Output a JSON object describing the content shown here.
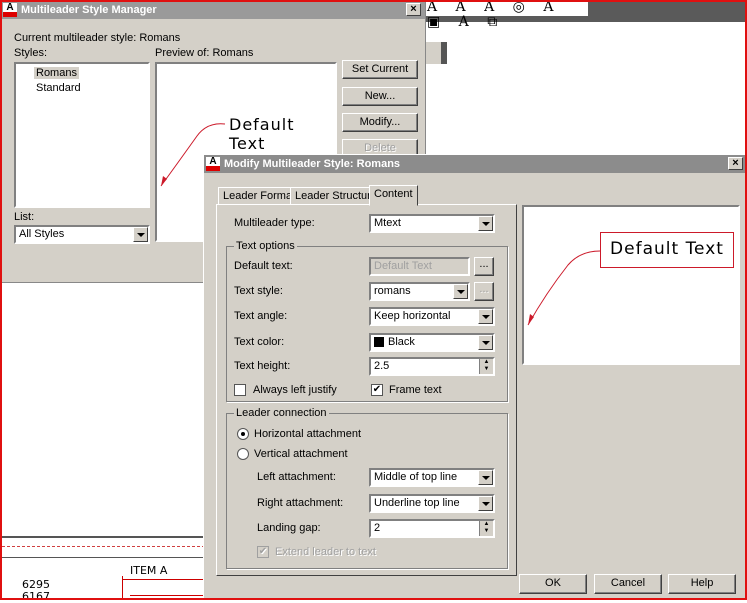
{
  "manager": {
    "title": "Multileader Style Manager",
    "current_style": "Current multileader style: Romans",
    "styles_label": "Styles:",
    "styles": [
      "Romans",
      "Standard"
    ],
    "preview_label": "Preview of: Romans",
    "preview_text": "Default Text",
    "buttons": {
      "set_current": "Set Current",
      "new": "New...",
      "modify": "Modify...",
      "delete": "Delete"
    },
    "list_label": "List:",
    "list_value": "All Styles"
  },
  "modify": {
    "title": "Modify Multileader Style: Romans",
    "tabs": [
      "Leader Format",
      "Leader Structure",
      "Content"
    ],
    "multileader_type_label": "Multileader type:",
    "multileader_type": "Mtext",
    "text_options": {
      "group": "Text options",
      "default_text_label": "Default text:",
      "default_text": "Default Text",
      "text_style_label": "Text style:",
      "text_style": "romans",
      "text_angle_label": "Text angle:",
      "text_angle": "Keep horizontal",
      "text_color_label": "Text color:",
      "text_color": "Black",
      "text_height_label": "Text height:",
      "text_height": "2.5",
      "always_left_justify": "Always left justify",
      "frame_text": "Frame text",
      "ellipsis": "..."
    },
    "leader_connection": {
      "group": "Leader connection",
      "horizontal": "Horizontal attachment",
      "vertical": "Vertical attachment",
      "left_label": "Left attachment:",
      "left_value": "Middle of top line",
      "right_label": "Right attachment:",
      "right_value": "Underline top line",
      "gap_label": "Landing gap:",
      "gap_value": "2",
      "extend": "Extend leader to text"
    },
    "preview_text": "Default Text",
    "buttons": {
      "ok": "OK",
      "cancel": "Cancel",
      "help": "Help"
    }
  },
  "drawing": {
    "item": "ITEM  A",
    "numbers": [
      "6295",
      "6167"
    ]
  },
  "close_glyph": "×",
  "colors": {
    "border": "#e01010",
    "leader": "#cc1a2a"
  }
}
